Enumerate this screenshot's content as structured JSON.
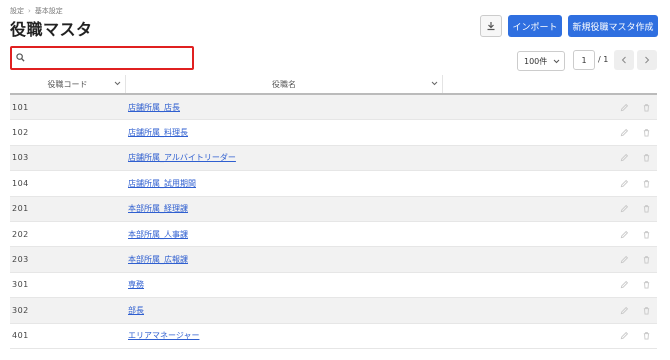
{
  "breadcrumb": {
    "items": [
      "設定",
      "基本設定"
    ],
    "separator": "›"
  },
  "page": {
    "title": "役職マスタ"
  },
  "toolbar": {
    "import_label": "インポート",
    "new_label": "新規役職マスタ作成"
  },
  "search": {
    "value": "",
    "placeholder": ""
  },
  "pagination": {
    "per_page": "100件",
    "current_page": "1",
    "total": "/ 1"
  },
  "table": {
    "columns": {
      "code": "役職コード",
      "name": "役職名"
    },
    "rows": [
      {
        "code": "101",
        "name": "店舗所属_店長"
      },
      {
        "code": "102",
        "name": "店舗所属_料理長"
      },
      {
        "code": "103",
        "name": "店舗所属_アルバイトリーダー"
      },
      {
        "code": "104",
        "name": "店舗所属_試用期間"
      },
      {
        "code": "201",
        "name": "本部所属_経理課"
      },
      {
        "code": "202",
        "name": "本部所属_人事課"
      },
      {
        "code": "203",
        "name": "本部所属_広報課"
      },
      {
        "code": "301",
        "name": "専務"
      },
      {
        "code": "302",
        "name": "部長"
      },
      {
        "code": "401",
        "name": "エリアマネージャー"
      }
    ]
  },
  "colors": {
    "primary": "#2f6fe0",
    "highlight": "#e02020",
    "link": "#2f5fd0"
  }
}
